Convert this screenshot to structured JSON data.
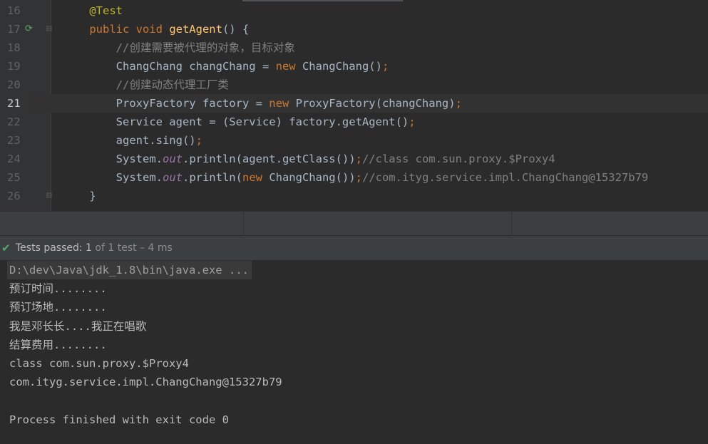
{
  "editor": {
    "lines": [
      {
        "num": "16",
        "tokens": [
          {
            "t": "    ",
            "c": "pl"
          },
          {
            "t": "@Test",
            "c": "ann"
          }
        ]
      },
      {
        "num": "17",
        "tokens": [
          {
            "t": "    ",
            "c": "pl"
          },
          {
            "t": "public void ",
            "c": "kw"
          },
          {
            "t": "getAgent",
            "c": "fn"
          },
          {
            "t": "() {",
            "c": "pl"
          }
        ]
      },
      {
        "num": "18",
        "tokens": [
          {
            "t": "        ",
            "c": "pl"
          },
          {
            "t": "//创建需要被代理的对象，目标对象",
            "c": "com"
          }
        ]
      },
      {
        "num": "19",
        "tokens": [
          {
            "t": "        ",
            "c": "pl"
          },
          {
            "t": "ChangChang changChang = ",
            "c": "pl"
          },
          {
            "t": "new ",
            "c": "kw"
          },
          {
            "t": "ChangChang()",
            "c": "pl"
          },
          {
            "t": ";",
            "c": "kw"
          }
        ]
      },
      {
        "num": "20",
        "tokens": [
          {
            "t": "        ",
            "c": "pl"
          },
          {
            "t": "//创建动态代理工厂类",
            "c": "com"
          }
        ]
      },
      {
        "num": "21",
        "tokens": [
          {
            "t": "        ",
            "c": "pl"
          },
          {
            "t": "ProxyFactory factory = ",
            "c": "pl"
          },
          {
            "t": "new ",
            "c": "kw"
          },
          {
            "t": "ProxyFactory(changChang)",
            "c": "pl"
          },
          {
            "t": ";",
            "c": "kw"
          }
        ]
      },
      {
        "num": "22",
        "tokens": [
          {
            "t": "        ",
            "c": "pl"
          },
          {
            "t": "Service agent = (Service) factory.getAgent()",
            "c": "pl"
          },
          {
            "t": ";",
            "c": "kw"
          }
        ]
      },
      {
        "num": "23",
        "tokens": [
          {
            "t": "        ",
            "c": "pl"
          },
          {
            "t": "agent.sing()",
            "c": "pl"
          },
          {
            "t": ";",
            "c": "kw"
          }
        ]
      },
      {
        "num": "24",
        "tokens": [
          {
            "t": "        ",
            "c": "pl"
          },
          {
            "t": "System.",
            "c": "pl"
          },
          {
            "t": "out",
            "c": "fld"
          },
          {
            "t": ".println(agent.getClass())",
            "c": "pl"
          },
          {
            "t": ";",
            "c": "kw"
          },
          {
            "t": "//class com.sun.proxy.$Proxy4",
            "c": "com"
          }
        ]
      },
      {
        "num": "25",
        "tokens": [
          {
            "t": "        ",
            "c": "pl"
          },
          {
            "t": "System.",
            "c": "pl"
          },
          {
            "t": "out",
            "c": "fld"
          },
          {
            "t": ".println(",
            "c": "pl"
          },
          {
            "t": "new ",
            "c": "kw"
          },
          {
            "t": "ChangChang())",
            "c": "pl"
          },
          {
            "t": ";",
            "c": "kw"
          },
          {
            "t": "//com.ityg.service.impl.ChangChang@15327b79",
            "c": "com"
          }
        ]
      },
      {
        "num": "26",
        "tokens": [
          {
            "t": "    ",
            "c": "pl"
          },
          {
            "t": "}",
            "c": "pl"
          }
        ]
      }
    ],
    "current_line": "21",
    "gutter_icons": {
      "run": "run-test-icon",
      "fold": "fold-icon"
    }
  },
  "run_panel": {
    "status_prefix": "Tests passed: ",
    "passed": "1",
    "status_suffix": " of 1 test – 4 ms",
    "check_icon": "check-icon",
    "colors": {
      "success": "#59a869"
    }
  },
  "console": {
    "lines": [
      "D:\\dev\\Java\\jdk_1.8\\bin\\java.exe ...",
      "预订时间........",
      "预订场地........",
      "我是邓长长....我正在唱歌",
      "结算费用........",
      "class com.sun.proxy.$Proxy4",
      "com.ityg.service.impl.ChangChang@15327b79",
      "",
      "Process finished with exit code 0"
    ]
  }
}
